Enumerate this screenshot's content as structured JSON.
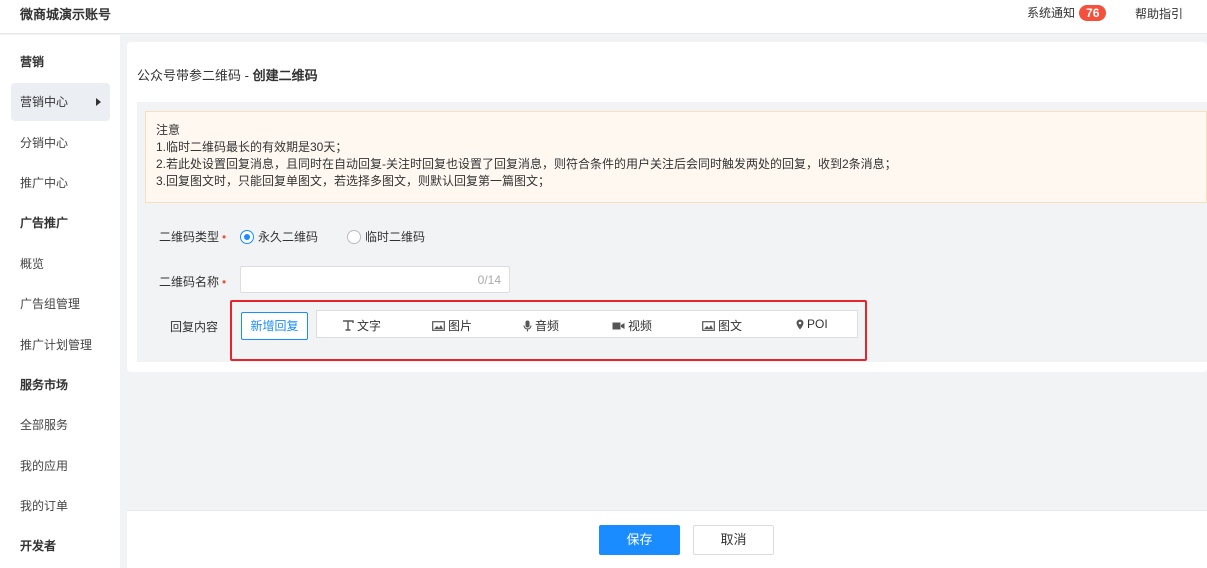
{
  "header": {
    "brand": "微商城演示账号",
    "notification_label": "系统通知",
    "notification_count": "76",
    "help_label": "帮助指引"
  },
  "sidebar": {
    "items": [
      {
        "label": "营销"
      },
      {
        "label": "营销中心"
      },
      {
        "label": "分销中心"
      },
      {
        "label": "推广中心"
      },
      {
        "label": "广告推广"
      },
      {
        "label": "概览"
      },
      {
        "label": "广告组管理"
      },
      {
        "label": "推广计划管理"
      },
      {
        "label": "服务市场"
      },
      {
        "label": "全部服务"
      },
      {
        "label": "我的应用"
      },
      {
        "label": "我的订单"
      },
      {
        "label": "开发者"
      }
    ]
  },
  "page": {
    "breadcrumb_parent": "公众号带参二维码 - ",
    "breadcrumb_current": "创建二维码"
  },
  "notice": {
    "title": "注意",
    "lines": [
      "1.临时二维码最长的有效期是30天；",
      "2.若此处设置回复消息，且同时在自动回复-关注时回复也设置了回复消息，则符合条件的用户关注后会同时触发两处的回复，收到2条消息；",
      "3.回复图文时，只能回复单图文，若选择多图文，则默认回复第一篇图文；"
    ]
  },
  "form": {
    "type_label": "二维码类型",
    "required_mark": "•",
    "option_permanent": "永久二维码",
    "option_temporary": "临时二维码",
    "name_label": "二维码名称",
    "name_value": "",
    "name_counter": "0/14",
    "reply_label": "回复内容",
    "add_reply_label": "新增回复",
    "reply_types": [
      {
        "label": "文字",
        "icon": "text-icon"
      },
      {
        "label": "图片",
        "icon": "image-icon"
      },
      {
        "label": "音频",
        "icon": "microphone-icon"
      },
      {
        "label": "视频",
        "icon": "video-icon"
      },
      {
        "label": "图文",
        "icon": "image-text-icon"
      },
      {
        "label": "POI",
        "icon": "location-pin-icon"
      }
    ]
  },
  "footer": {
    "save_label": "保存",
    "cancel_label": "取消"
  },
  "colors": {
    "primary": "#1a8cff",
    "badge": "#f5503b",
    "highlight_border": "#e8232b",
    "notice_bg": "#fef8f0"
  }
}
